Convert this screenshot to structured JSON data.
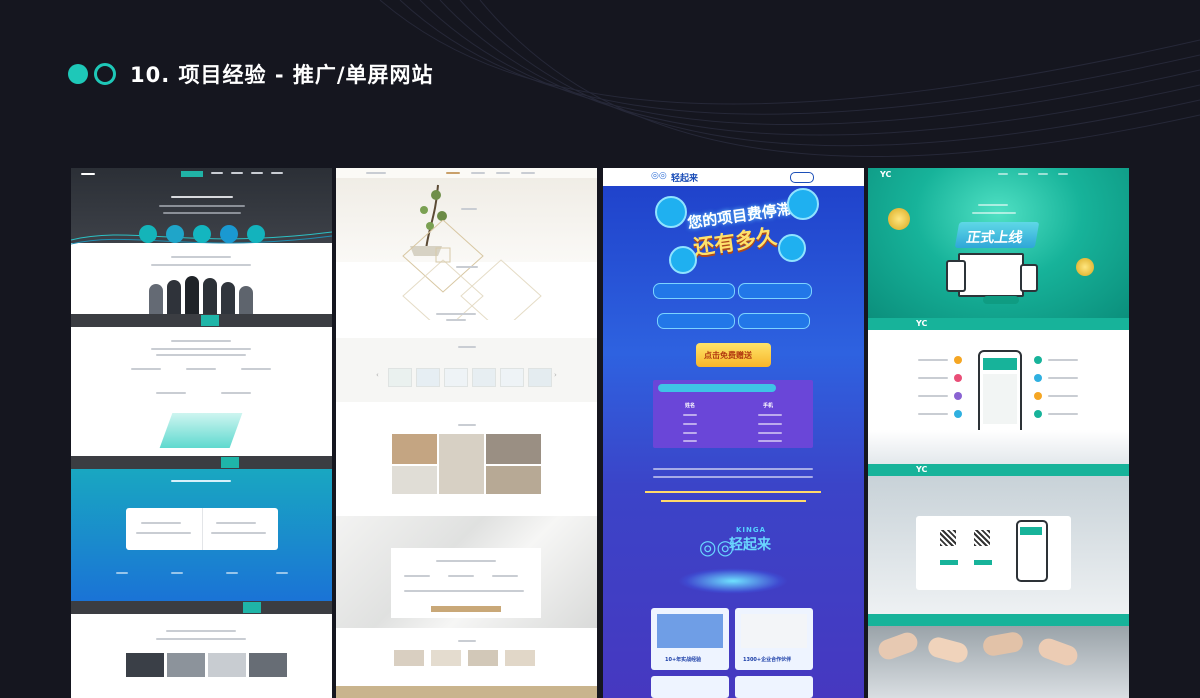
{
  "header": {
    "title": "10. 项目经验 - 推广/单屏网站"
  },
  "colors": {
    "accent": "#1ec8b8",
    "background": "#15161f",
    "blue_panel": "#2a3cc6",
    "green_panel": "#19b38c"
  },
  "panels": [
    {
      "name": "corporate-site",
      "theme": "teal/blue"
    },
    {
      "name": "zen-tea-site",
      "theme": "beige/white"
    },
    {
      "name": "kinga-promo",
      "theme": "blue/purple",
      "hero_line1": "您的项目费停滞",
      "hero_line2": "还有多久",
      "bubbles": [
        "模式落后",
        "招商困难",
        "利润低",
        "产品不明"
      ],
      "cta": "点击免费赠送",
      "brand_en": "KINGA",
      "brand_cn": "轻起来",
      "stat_1": "10+年实战经验",
      "stat_2": "1300+企业合作伙伴",
      "table_col_name": "姓名",
      "table_col_phone": "手机"
    },
    {
      "name": "app-launch-site",
      "theme": "green/teal",
      "hero_text": "正式上线"
    }
  ],
  "icons": [
    "circle-filled-icon",
    "circle-outline-icon",
    "kinga-logo-icon"
  ]
}
